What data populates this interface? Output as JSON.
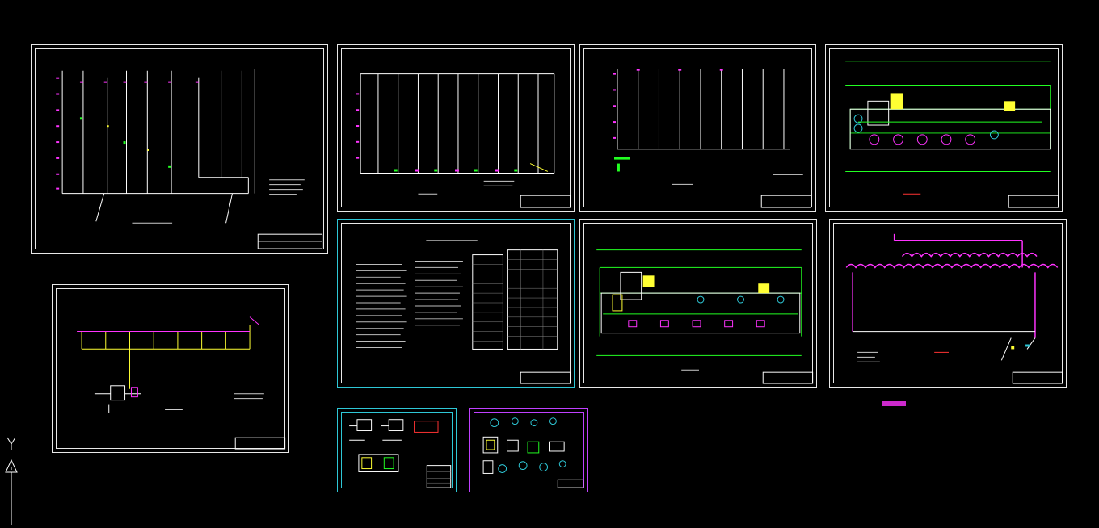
{
  "viewport": {
    "background": "#000000"
  },
  "colors": {
    "frame": "#e8e8e8",
    "pipe_main": "#ffffff",
    "pipe_magenta": "#ff33ff",
    "pipe_green": "#22ff22",
    "pipe_yellow": "#ffff33",
    "pipe_cyan": "#2ec7d6",
    "pipe_red": "#ff3333"
  },
  "sheets": [
    {
      "id": "sheet-1",
      "kind": "riser-diagram"
    },
    {
      "id": "sheet-2",
      "kind": "riser-diagram"
    },
    {
      "id": "sheet-3",
      "kind": "riser-diagram"
    },
    {
      "id": "sheet-4",
      "kind": "floor-plan"
    },
    {
      "id": "sheet-5",
      "kind": "pipe-system-diagram"
    },
    {
      "id": "sheet-6",
      "kind": "design-notes-and-legend"
    },
    {
      "id": "sheet-7",
      "kind": "floor-plan"
    },
    {
      "id": "sheet-8",
      "kind": "pipe-system-diagram"
    },
    {
      "id": "sheet-9",
      "kind": "detail-drawings"
    },
    {
      "id": "sheet-10",
      "kind": "detail-drawings"
    }
  ],
  "ucs": {
    "y_label": "Y",
    "icon": "ucs-icon"
  }
}
